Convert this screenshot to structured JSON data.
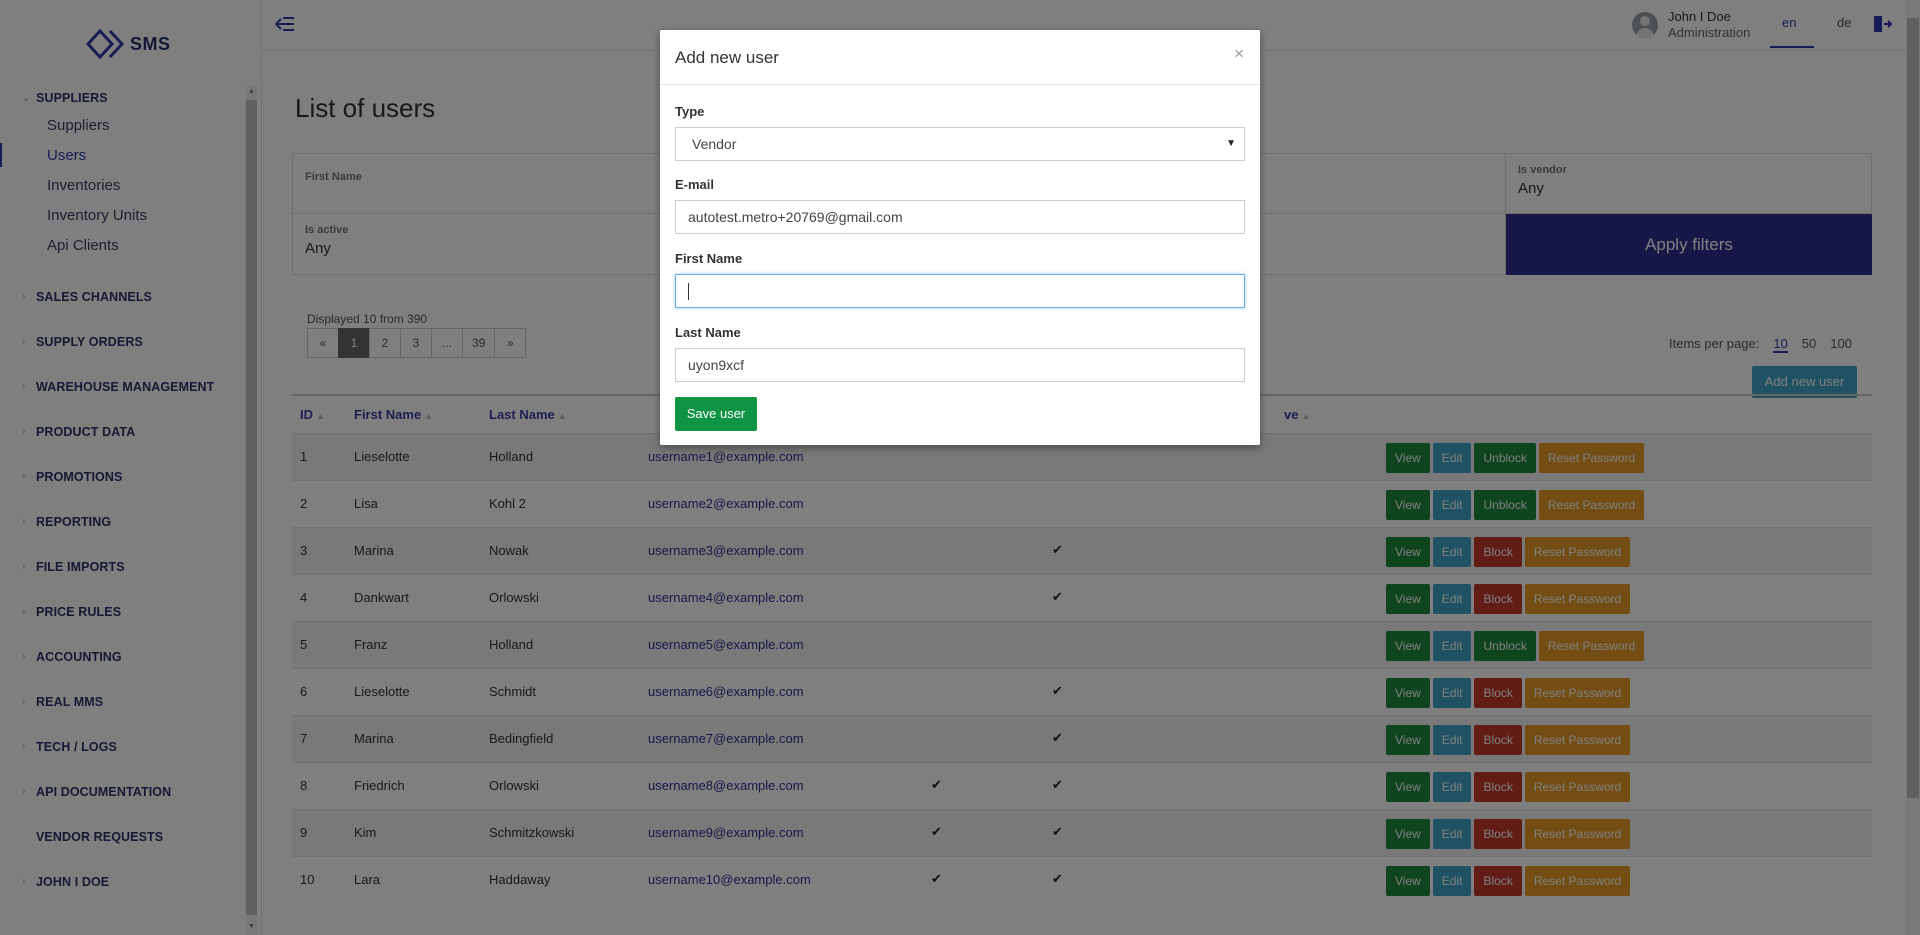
{
  "app": {
    "logo_text": "SMS"
  },
  "sidebar": {
    "open_group": "SUPPLIERS",
    "sub_items": [
      "Suppliers",
      "Users",
      "Inventories",
      "Inventory Units",
      "Api Clients"
    ],
    "groups": [
      "SALES CHANNELS",
      "SUPPLY ORDERS",
      "WAREHOUSE MANAGEMENT",
      "PRODUCT DATA",
      "PROMOTIONS",
      "REPORTING",
      "FILE IMPORTS",
      "PRICE RULES",
      "ACCOUNTING",
      "REAL MMS",
      "TECH / LOGS",
      "API DOCUMENTATION",
      "VENDOR REQUESTS",
      "JOHN I DOE"
    ]
  },
  "header": {
    "user_name": "John I Doe",
    "user_role": "Administration",
    "lang_en": "en",
    "lang_de": "de"
  },
  "page": {
    "title": "List of users",
    "filters": {
      "first_name_label": "First Name",
      "is_vendor_label": "Is vendor",
      "is_vendor_value": "Any",
      "is_active_label": "Is active",
      "is_active_value": "Any",
      "apply_label": "Apply filters"
    },
    "displayed_text": "Displayed 10 from 390",
    "pager": [
      "«",
      "1",
      "2",
      "3",
      "...",
      "39",
      "»"
    ],
    "items_per_page_label": "Items per page:",
    "items_per_page_options": [
      "10",
      "50",
      "100"
    ],
    "add_new_user_label": "Add new user"
  },
  "table": {
    "headers": {
      "id": "ID",
      "first_name": "First Name",
      "last_name": "Last Name",
      "active_partial": "ve"
    },
    "rows": [
      {
        "id": "1",
        "first": "Lieselotte",
        "last": "Holland",
        "email": "username1@example.com",
        "vendor": false,
        "active": false,
        "blocked": true
      },
      {
        "id": "2",
        "first": "Lisa",
        "last": "Kohl 2",
        "email": "username2@example.com",
        "vendor": false,
        "active": false,
        "blocked": true
      },
      {
        "id": "3",
        "first": "Marina",
        "last": "Nowak",
        "email": "username3@example.com",
        "vendor": false,
        "active": true,
        "blocked": false
      },
      {
        "id": "4",
        "first": "Dankwart",
        "last": "Orlowski",
        "email": "username4@example.com",
        "vendor": false,
        "active": true,
        "blocked": false
      },
      {
        "id": "5",
        "first": "Franz",
        "last": "Holland",
        "email": "username5@example.com",
        "vendor": false,
        "active": false,
        "blocked": true
      },
      {
        "id": "6",
        "first": "Lieselotte",
        "last": "Schmidt",
        "email": "username6@example.com",
        "vendor": false,
        "active": true,
        "blocked": false
      },
      {
        "id": "7",
        "first": "Marina",
        "last": "Bedingfield",
        "email": "username7@example.com",
        "vendor": false,
        "active": true,
        "blocked": false
      },
      {
        "id": "8",
        "first": "Friedrich",
        "last": "Orlowski",
        "email": "username8@example.com",
        "vendor": true,
        "active": true,
        "blocked": false
      },
      {
        "id": "9",
        "first": "Kim",
        "last": "Schmitzkowski",
        "email": "username9@example.com",
        "vendor": true,
        "active": true,
        "blocked": false
      },
      {
        "id": "10",
        "first": "Lara",
        "last": "Haddaway",
        "email": "username10@example.com",
        "vendor": true,
        "active": true,
        "blocked": false
      }
    ],
    "actions": {
      "view": "View",
      "edit": "Edit",
      "block": "Block",
      "unblock": "Unblock",
      "reset": "Reset Password"
    },
    "check_glyph": "✔"
  },
  "modal": {
    "title": "Add new user",
    "close": "×",
    "type_label": "Type",
    "type_value": "Vendor",
    "email_label": "E-mail",
    "email_value": "autotest.metro+20769@gmail.com",
    "first_name_label": "First Name",
    "first_name_value": "",
    "last_name_label": "Last Name",
    "last_name_value": "uyon9xcf",
    "save_label": "Save user"
  },
  "colors": {
    "brand": "#2e3190",
    "view": "#1e8a3c",
    "edit": "#3fa6c7",
    "block": "#c0392b",
    "reset": "#e79b28",
    "save": "#0f9344"
  }
}
